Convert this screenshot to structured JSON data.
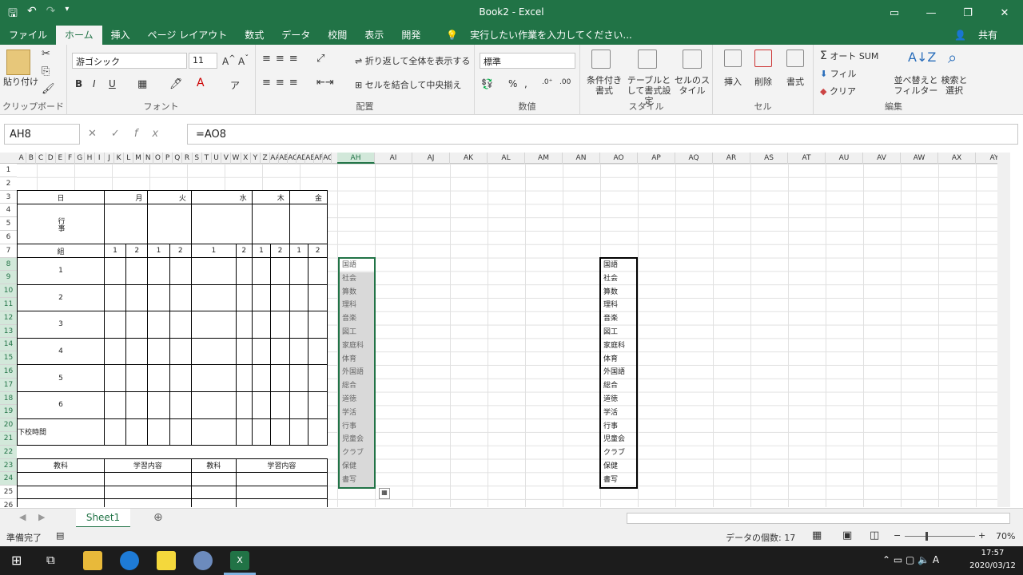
{
  "window": {
    "title": "Book2 - Excel"
  },
  "tabs": [
    "ファイル",
    "ホーム",
    "挿入",
    "ページ レイアウト",
    "数式",
    "データ",
    "校閲",
    "表示",
    "開発"
  ],
  "tell_me": "実行したい作業を入力してください...",
  "share": "共有",
  "ribbon": {
    "paste": "貼り付け",
    "font_name": "游ゴシック",
    "font_size": "11",
    "wrap_text": "折り返して全体を表示する",
    "merge_center": "セルを結合して中央揃え",
    "number_format": "標準",
    "cond_format": "条件付き書式",
    "table_format": "テーブルとして書式設定",
    "cell_style": "セルのスタイル",
    "insert": "挿入",
    "delete": "削除",
    "format": "書式",
    "autosum": "オート SUM",
    "fill": "フィル",
    "clear": "クリア",
    "sort_filter": "並べ替えとフィルター",
    "find_select": "検索と選択",
    "groups": [
      "クリップボード",
      "フォント",
      "配置",
      "数値",
      "スタイル",
      "セル",
      "編集"
    ]
  },
  "formula": {
    "name_box": "AH8",
    "content": "=AO8"
  },
  "columns_small": [
    "A",
    "B",
    "C",
    "D",
    "E",
    "F",
    "G",
    "H",
    "I",
    "J",
    "K",
    "L",
    "M",
    "N",
    "O",
    "P",
    "Q",
    "R",
    "S",
    "T",
    "U",
    "V",
    "W",
    "X",
    "Y",
    "Z",
    "AA",
    "AB",
    "AC",
    "AD",
    "AE",
    "AF",
    "AG"
  ],
  "columns_wide": [
    "AH",
    "AI",
    "AJ",
    "AK",
    "AL",
    "AM",
    "AN",
    "AO",
    "AP",
    "AQ",
    "AR",
    "AS",
    "AT",
    "AU",
    "AV",
    "AW",
    "AX",
    "AY"
  ],
  "rows": [
    "1",
    "2",
    "3",
    "4",
    "5",
    "6",
    "7",
    "8",
    "9",
    "10",
    "11",
    "12",
    "13",
    "14",
    "15",
    "16",
    "17",
    "18",
    "19",
    "20",
    "21",
    "22",
    "23",
    "24",
    "25",
    "26"
  ],
  "timetable": {
    "days": [
      "日",
      "月",
      "火",
      "水",
      "木",
      "金"
    ],
    "event_label": "行事",
    "class_label": "組",
    "class_nums": [
      "1",
      "2",
      "1",
      "2",
      "1",
      "2",
      "1",
      "2",
      "1",
      "2"
    ],
    "periods": [
      "1",
      "2",
      "3",
      "4",
      "5",
      "6"
    ],
    "after_school": "下校時間",
    "bottom_headers": [
      "教科",
      "学習内容",
      "教科",
      "学習内容"
    ]
  },
  "subjects": [
    "国語",
    "社会",
    "算数",
    "理科",
    "音楽",
    "図工",
    "家庭科",
    "体育",
    "外国語",
    "総合",
    "道徳",
    "学活",
    "行事",
    "児童会",
    "クラブ",
    "保健",
    "書写"
  ],
  "sheet_tab": "Sheet1",
  "status": {
    "ready": "準備完了",
    "count": "データの個数: 17",
    "zoom": "70%"
  },
  "clock": {
    "time": "17:57",
    "date": "2020/03/12"
  }
}
